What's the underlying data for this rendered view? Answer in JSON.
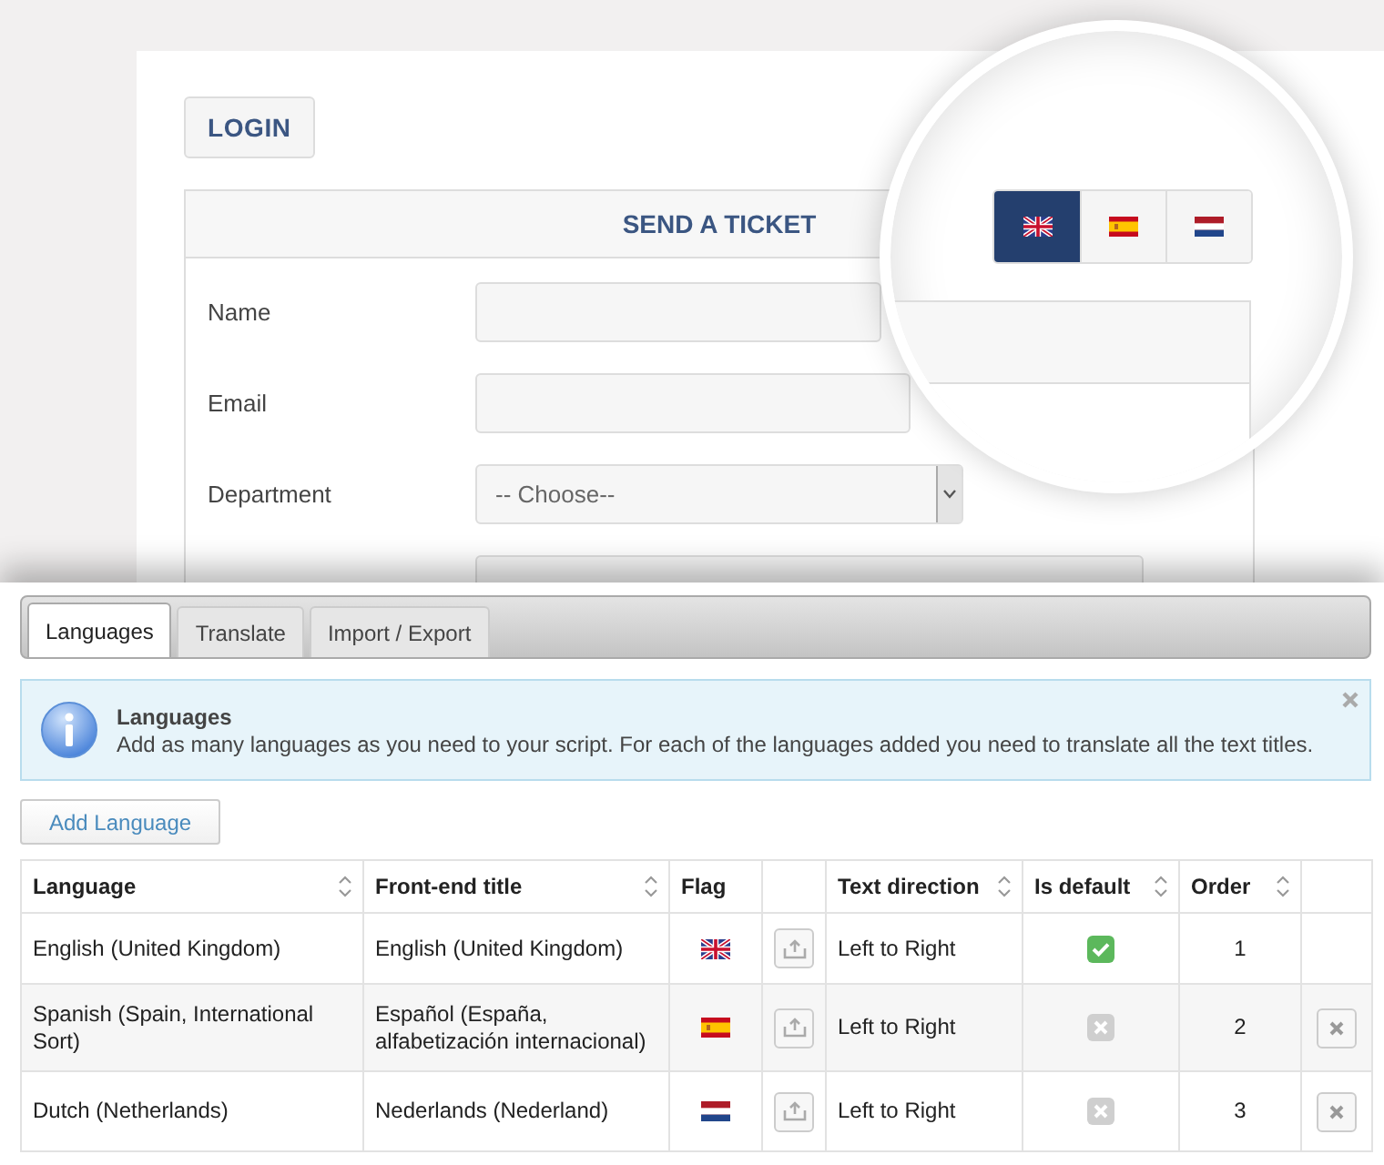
{
  "ticket_page": {
    "login_button": "LOGIN",
    "title": "SEND A TICKET",
    "fields": [
      {
        "kind": "input",
        "label": "Name"
      },
      {
        "kind": "input",
        "label": "Email"
      },
      {
        "kind": "select",
        "label": "Department",
        "value": "-- Choose--"
      }
    ],
    "language_switcher": [
      {
        "kind": "gb",
        "selected": true
      },
      {
        "kind": "es",
        "selected": false
      },
      {
        "kind": "nl",
        "selected": false
      }
    ]
  },
  "admin": {
    "tabs": [
      {
        "label": "Languages",
        "selected": true
      },
      {
        "label": "Translate",
        "selected": false
      },
      {
        "label": "Import / Export",
        "selected": false
      }
    ],
    "notice": {
      "title": "Languages",
      "text": "Add as many languages as you need to your script. For each of the languages added you need to translate all the text titles."
    },
    "add_button": "Add Language",
    "table": {
      "columns": [
        {
          "label": "Language",
          "sortable": true
        },
        {
          "label": "Front-end title",
          "sortable": true
        },
        {
          "label": "Flag",
          "sortable": false
        },
        {
          "label": "Text direction",
          "sortable": true
        },
        {
          "label": "Is default",
          "sortable": true
        },
        {
          "label": "Order",
          "sortable": true
        }
      ],
      "rows": [
        {
          "language": "English (United Kingdom)",
          "title": "English (United Kingdom)",
          "kind": "gb",
          "direction": "Left to Right",
          "is_default": true,
          "order": "1"
        },
        {
          "language": "Spanish (Spain, International Sort)",
          "title": "Español (España, alfabetización internacional)",
          "kind": "es",
          "direction": "Left to Right",
          "is_default": false,
          "order": "2"
        },
        {
          "language": "Dutch (Netherlands)",
          "title": "Nederlands (Nederland)",
          "kind": "nl",
          "direction": "Left to Right",
          "is_default": false,
          "order": "3"
        }
      ]
    }
  }
}
